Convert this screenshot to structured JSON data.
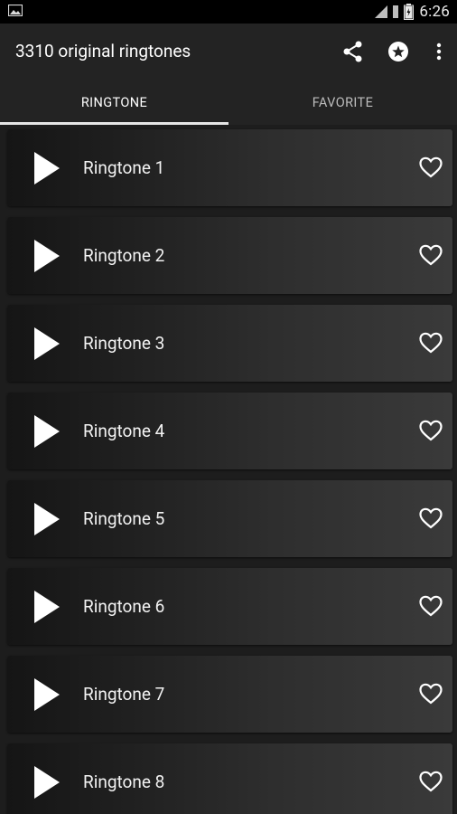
{
  "status_bar": {
    "time": "6:26",
    "icons": [
      "image-notification-icon",
      "wifi-icon",
      "signal-icon",
      "battery-icon"
    ]
  },
  "app_bar": {
    "title": "3310 original ringtones",
    "actions": [
      "share-icon",
      "star-icon",
      "more-vert-icon"
    ]
  },
  "tabs": [
    {
      "label": "RINGTONE",
      "active": true
    },
    {
      "label": "FAVORITE",
      "active": false
    }
  ],
  "ringtones": [
    {
      "label": "Ringtone 1"
    },
    {
      "label": "Ringtone 2"
    },
    {
      "label": "Ringtone 3"
    },
    {
      "label": "Ringtone 4"
    },
    {
      "label": "Ringtone 5"
    },
    {
      "label": "Ringtone 6"
    },
    {
      "label": "Ringtone 7"
    },
    {
      "label": "Ringtone 8"
    }
  ],
  "colors": {
    "status_bar": "#000000",
    "app_bar": "#232323",
    "tab_indicator": "#e6e6e6",
    "background": "#1d1d1d"
  }
}
